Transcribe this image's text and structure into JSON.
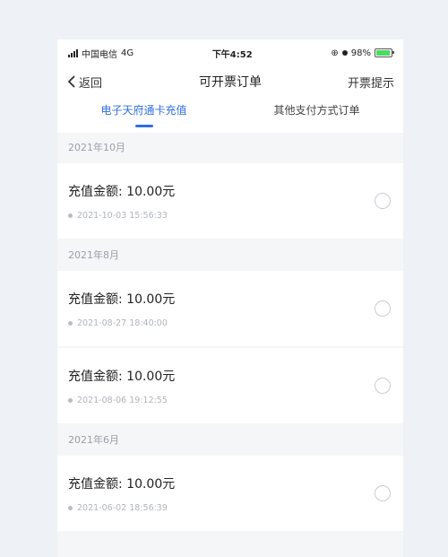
{
  "status_bar": {
    "carrier": "中国电信",
    "network": "4G",
    "time": "下午4:52",
    "battery": "98%"
  },
  "nav": {
    "back_label": "返回",
    "title": "可开票订单",
    "right_label": "开票提示"
  },
  "tabs": [
    {
      "label": "电子天府通卡充值",
      "active": true
    },
    {
      "label": "其他支付方式订单",
      "active": false
    }
  ],
  "sections": [
    {
      "header": "2021年10月",
      "orders": [
        {
          "amount": "充值金额: 10.00元",
          "time": "2021-10-03 15:56:33"
        }
      ]
    },
    {
      "header": "2021年8月",
      "orders": [
        {
          "amount": "充值金额: 10.00元",
          "time": "2021-08-27 18:40:00"
        },
        {
          "amount": "充值金额: 10.00元",
          "time": "2021-08-06 19:12:55"
        }
      ]
    },
    {
      "header": "2021年6月",
      "orders": [
        {
          "amount": "充值金额: 10.00元",
          "time": "2021-06-02 18:56:39"
        }
      ]
    }
  ],
  "colors": {
    "accent": "#2f6fe4",
    "page_bg": "#f5f6f8",
    "muted_text": "#9aa0a8"
  }
}
